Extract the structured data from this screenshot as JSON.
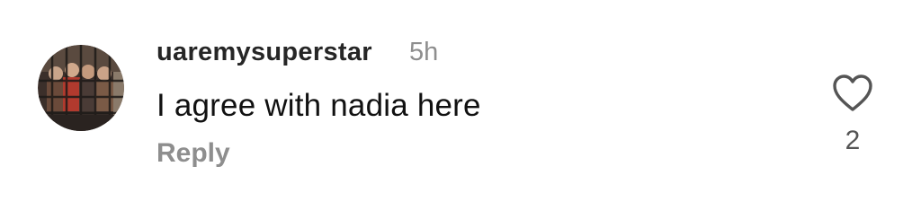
{
  "comment": {
    "username": "uaremysuperstar",
    "timestamp": "5h",
    "text": "I agree with nadia here",
    "reply_label": "Reply",
    "like_count": "2",
    "avatar_icon": "profile-photo",
    "like_icon": "heart-outline-icon"
  },
  "colors": {
    "username": "#262626",
    "secondary_text": "#8e8e8e",
    "body_text": "#111111",
    "icon": "#555555"
  }
}
